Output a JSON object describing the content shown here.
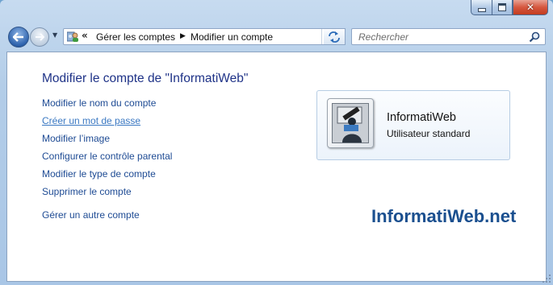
{
  "window": {
    "caption_buttons": {
      "minimize": "minimize-icon",
      "maximize": "maximize-icon",
      "close": "✕"
    }
  },
  "nav": {
    "back_icon": "back-arrow-icon",
    "forward_icon": "forward-arrow-icon",
    "overflow": "«",
    "breadcrumbs": [
      "Gérer les comptes",
      "Modifier un compte"
    ]
  },
  "search": {
    "placeholder": "Rechercher"
  },
  "content": {
    "heading": "Modifier le compte de \"InformatiWeb\"",
    "tasks": [
      "Modifier le nom du compte",
      "Créer un mot de passe",
      "Modifier l’image",
      "Configurer le contrôle parental",
      "Modifier le type de compte",
      "Supprimer le compte"
    ],
    "other_task": "Gérer un autre compte"
  },
  "user_card": {
    "name": "InformatiWeb",
    "type": "Utilisateur standard"
  },
  "watermark": "InformatiWeb.net",
  "colors": {
    "link": "#1e4b94",
    "link_hover": "#3a78c2",
    "heading": "#1e3287",
    "chrome": "#b3cde8"
  }
}
